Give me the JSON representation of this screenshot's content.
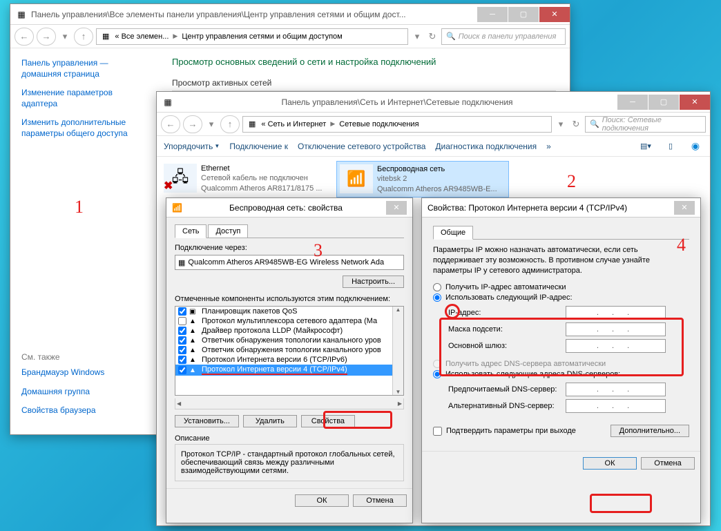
{
  "win1": {
    "title": "Панель управления\\Все элементы панели управления\\Центр управления сетями и общим дост...",
    "crumb1": "« Все элемен...",
    "crumb2": "Центр управления сетями и общим доступом",
    "search_ph": "Поиск в панели управления",
    "side_home1": "Панель управления —",
    "side_home2": "домашняя страница",
    "side_link1": "Изменение параметров адаптера",
    "side_link2": "Изменить дополнительные параметры общего доступа",
    "side_see_also": "См. также",
    "side_b1": "Брандмауэр Windows",
    "side_b2": "Домашняя группа",
    "side_b3": "Свойства браузера",
    "main_h": "Просмотр основных сведений о сети и настройка подключений",
    "main_sub": "Просмотр активных сетей"
  },
  "win2": {
    "title": "Панель управления\\Сеть и Интернет\\Сетевые подключения",
    "crumb1": "« Сеть и Интернет",
    "crumb2": "Сетевые подключения",
    "search_ph": "Поиск: Сетевые подключения",
    "tb_org": "Упорядочить",
    "tb_conn": "Подключение к",
    "tb_disable": "Отключение сетевого устройства",
    "tb_diag": "Диагностика подключения",
    "conn1_name": "Ethernet",
    "conn1_l2": "Сетевой кабель не подключен",
    "conn1_l3": "Qualcomm Atheros AR8171/8175 ...",
    "conn2_name": "Беспроводная сеть",
    "conn2_l2": "vitebsk 2",
    "conn2_l3": "Qualcomm Atheros AR9485WB-E..."
  },
  "dlg3": {
    "title": "Беспроводная сеть: свойства",
    "tab1": "Сеть",
    "tab2": "Доступ",
    "conn_via_lbl": "Подключение через:",
    "adapter": "Qualcomm Atheros AR9485WB-EG Wireless Network Ada",
    "btn_configure": "Настроить...",
    "components_lbl": "Отмеченные компоненты используются этим подключением:",
    "c1": "Планировщик пакетов QoS",
    "c2": "Протокол мультиплексора сетевого адаптера (Ма",
    "c3": "Драйвер протокола LLDP (Майкрософт)",
    "c4": "Ответчик обнаружения топологии канального уров",
    "c5": "Ответчик обнаружения топологии канального уров",
    "c6": "Протокол Интернета версии 6 (TCP/IPv6)",
    "c7": "Протокол Интернета версии 4 (TCP/IPv4)",
    "btn_install": "Установить...",
    "btn_remove": "Удалить",
    "btn_props": "Свойства",
    "desc_title": "Описание",
    "desc_text": "Протокол TCP/IP - стандартный протокол глобальных сетей, обеспечивающий связь между различными взаимодействующими сетями.",
    "btn_ok": "ОК",
    "btn_cancel": "Отмена"
  },
  "dlg4": {
    "title": "Свойства: Протокол Интернета версии 4 (TCP/IPv4)",
    "tab1": "Общие",
    "explain": "Параметры IP можно назначать автоматически, если сеть поддерживает эту возможность. В противном случае узнайте параметры IP у сетевого администратора.",
    "r1": "Получить IP-адрес автоматически",
    "r2": "Использовать следующий IP-адрес:",
    "ip_lbl": "IP-адрес:",
    "mask_lbl": "Маска подсети:",
    "gw_lbl": "Основной шлюз:",
    "dns_r1": "Получить адрес DNS-сервера автоматически",
    "dns_r2": "Использовать следующие адреса DNS-серверов:",
    "dns1_lbl": "Предпочитаемый DNS-сервер:",
    "dns2_lbl": "Альтернативный DNS-сервер:",
    "chk_validate": "Подтвердить параметры при выходе",
    "btn_adv": "Дополнительно...",
    "btn_ok": "ОК",
    "btn_cancel": "Отмена",
    "ip_placeholder": ".       .       ."
  },
  "annotations": {
    "n1": "1",
    "n2": "2",
    "n3": "3",
    "n4": "4"
  }
}
